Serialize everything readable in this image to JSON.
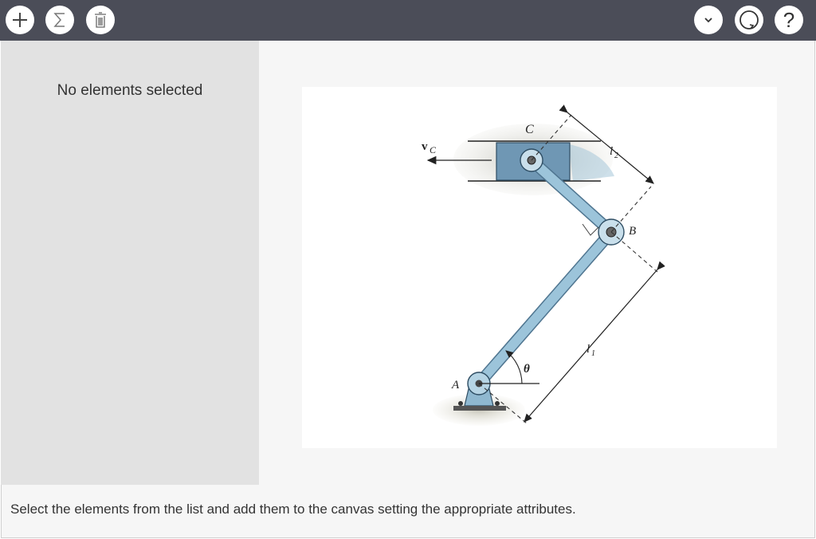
{
  "toolbar": {
    "left_icons": [
      "plus-icon",
      "sigma-icon",
      "trash-icon"
    ],
    "right_icons": [
      "chevron-down-icon",
      "reset-icon",
      "help-icon"
    ],
    "help_glyph": "?"
  },
  "sidepanel": {
    "message": "No elements selected"
  },
  "figure": {
    "labels": {
      "velocity": "v",
      "velocity_sub": "C",
      "point_c": "C",
      "point_b": "B",
      "point_a": "A",
      "angle": "θ",
      "length_1": "l",
      "length_1_sub": "1",
      "length_2": "l",
      "length_2_sub": "2"
    }
  },
  "instructions": "Select the elements from the list and add them to the canvas setting the appropriate attributes.",
  "colors": {
    "toolbar_bg": "#4b4d58",
    "panel_bg": "#e2e2e2",
    "link_color": "#8fb8d0",
    "block_color": "#6f97b4"
  }
}
